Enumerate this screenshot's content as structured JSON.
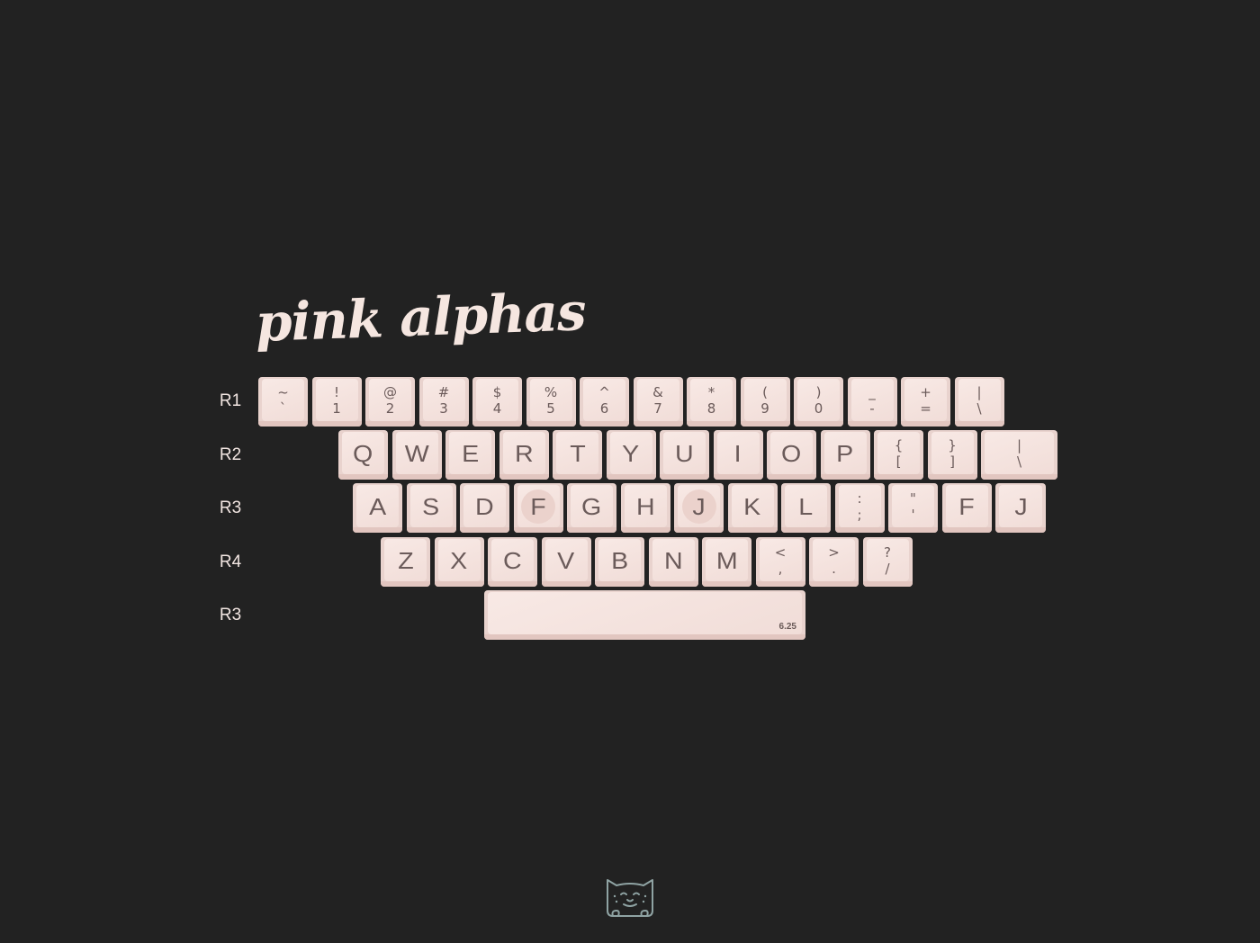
{
  "title": "pink alphas",
  "colors": {
    "background": "#222222",
    "key_top": "#f1ddd8",
    "key_side": "#e2c6c0",
    "legend": "#6b5b5a",
    "title": "#f5e6e0",
    "logo": "#8fa3a3"
  },
  "row_labels": [
    "R1",
    "R2",
    "R3",
    "R4",
    "R3"
  ],
  "rows": [
    {
      "keys": [
        {
          "top": "~",
          "bottom": "`"
        },
        {
          "top": "!",
          "bottom": "1"
        },
        {
          "top": "@",
          "bottom": "2"
        },
        {
          "top": "#",
          "bottom": "3"
        },
        {
          "top": "$",
          "bottom": "4"
        },
        {
          "top": "%",
          "bottom": "5"
        },
        {
          "top": "^",
          "bottom": "6"
        },
        {
          "top": "&",
          "bottom": "7"
        },
        {
          "top": "*",
          "bottom": "8"
        },
        {
          "top": "(",
          "bottom": "9"
        },
        {
          "top": ")",
          "bottom": "0"
        },
        {
          "top": "_",
          "bottom": "-"
        },
        {
          "top": "+",
          "bottom": "="
        },
        {
          "top": "|",
          "bottom": "\\"
        }
      ]
    },
    {
      "keys": [
        {
          "alpha": "Q"
        },
        {
          "alpha": "W"
        },
        {
          "alpha": "E"
        },
        {
          "alpha": "R"
        },
        {
          "alpha": "T"
        },
        {
          "alpha": "Y"
        },
        {
          "alpha": "U"
        },
        {
          "alpha": "I"
        },
        {
          "alpha": "O"
        },
        {
          "alpha": "P"
        },
        {
          "top": "{",
          "bottom": "["
        },
        {
          "top": "}",
          "bottom": "]"
        },
        {
          "top": "|",
          "bottom": "\\"
        }
      ]
    },
    {
      "keys": [
        {
          "alpha": "A"
        },
        {
          "alpha": "S"
        },
        {
          "alpha": "D"
        },
        {
          "alpha": "F",
          "homing": true
        },
        {
          "alpha": "G"
        },
        {
          "alpha": "H"
        },
        {
          "alpha": "J",
          "homing": true
        },
        {
          "alpha": "K"
        },
        {
          "alpha": "L"
        },
        {
          "top": ":",
          "bottom": ";"
        },
        {
          "top": "\"",
          "bottom": "'"
        },
        {
          "alpha": "F"
        },
        {
          "alpha": "J"
        }
      ]
    },
    {
      "keys": [
        {
          "alpha": "Z"
        },
        {
          "alpha": "X"
        },
        {
          "alpha": "C"
        },
        {
          "alpha": "V"
        },
        {
          "alpha": "B"
        },
        {
          "alpha": "N"
        },
        {
          "alpha": "M"
        },
        {
          "top": "<",
          "bottom": ","
        },
        {
          "top": ">",
          "bottom": "."
        },
        {
          "top": "?",
          "bottom": "/"
        }
      ]
    },
    {
      "keys": [
        {
          "size_label": "6.25"
        }
      ]
    }
  ],
  "logo_icon": "cat-face-icon"
}
